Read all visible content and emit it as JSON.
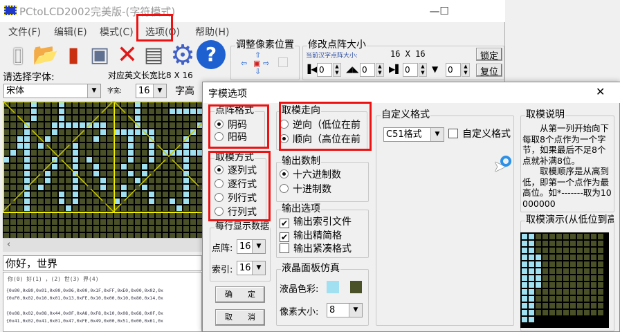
{
  "window": {
    "title": "PCtoLCD2002完美版-(字符模式)",
    "min": "—",
    "max": "☐"
  },
  "menu": [
    "文件(F)",
    "编辑(E)",
    "模式(C)",
    "选项(O)",
    "帮助(H)"
  ],
  "toolbar_icons": [
    "new-icon",
    "open-icon",
    "save-icon",
    "disk-restore-icon",
    "delete-icon",
    "document-icon",
    "gear-icon",
    "help-icon"
  ],
  "pixel_adjust": {
    "label": "调整像素位置"
  },
  "matrix_size": {
    "label": "修改点阵大小",
    "current_label": "当前汉字点阵大小:",
    "current_value": "16 X 16",
    "lock": "锁定",
    "reset": "复位",
    "spins": [
      "0",
      "0",
      "0",
      "0"
    ]
  },
  "font": {
    "label": "请选择字体:",
    "value": "宋体",
    "ratio": "对应英文长宽比8 X 16",
    "width_label": "字宽:",
    "width_value": "16",
    "height_label": "字高"
  },
  "input_text": "你好，世界",
  "output": {
    "index_line": "你(0) 好(1) ，(2) 世(3) 界(4)",
    "lines": [
      "{0x00,0x80,0x01,0x00,0x06,0x00,0x1F,0xFF,0xE0,0x00,0x02,0x",
      "{0xF0,0x02,0x10,0x01,0x13,0xFE,0x10,0x00,0x10,0x80,0x14,0x",
      "",
      "{0x08,0x02,0x08,0x44,0x0F,0xA8,0xF8,0x10,0x08,0x68,0x0F,0x",
      "{0x41,0x02,0x41,0x01,0x47,0xFE,0x49,0x00,0x51,0x00,0x61,0x"
    ]
  },
  "dialog": {
    "title": "字模选项",
    "close": "✕",
    "dot_format": {
      "label": "点阵格式",
      "options": [
        "阴码",
        "阳码"
      ],
      "selected": 0
    },
    "mode": {
      "label": "取模方式",
      "options": [
        "逐列式",
        "逐行式",
        "列行式",
        "行列式"
      ],
      "selected": 0
    },
    "direction": {
      "label": "取模走向",
      "options": [
        "逆向（低位在前",
        "顺向（高位在前"
      ],
      "selected": 1
    },
    "radix": {
      "label": "输出数制",
      "options": [
        "十六进制数",
        "十进制数"
      ],
      "selected": 0
    },
    "output_opts": {
      "label": "输出选项",
      "items": [
        {
          "label": "输出索引文件",
          "checked": true
        },
        {
          "label": "输出精简格",
          "checked": true
        },
        {
          "label": "输出紧凑格式",
          "checked": false
        }
      ]
    },
    "per_line": {
      "label": "每行显示数据",
      "dot_label": "点阵:",
      "dot_value": "16",
      "index_label": "索引:",
      "index_value": "16"
    },
    "ok": "确　　定",
    "cancel": "取　　消",
    "lcd": {
      "label": "液晶面板仿真",
      "color_label": "液晶色彩:",
      "on_color": "#a0e0f0",
      "off_color": "#4a5028",
      "pixel_label": "像素大小:",
      "pixel_value": "8"
    },
    "custom": {
      "label": "自定义格式",
      "select": "C51格式",
      "check_label": "自定义格式"
    },
    "explain": {
      "label": "取模说明",
      "text": "　　从第一列开始向下每取8个点作为一个字节，如果最后不足8个点就补满8位。\n　　取模顺序是从高到低，即第一个点作为最高位。如*-------取为10000000"
    },
    "demo": {
      "label": "取模演示(从低位到高位)"
    }
  },
  "bitmap": {
    "char1": [
      [
        4,
        8
      ],
      [
        4,
        8
      ],
      [
        4,
        8
      ],
      [
        3,
        7,
        8,
        9,
        10,
        11,
        12,
        13,
        14
      ],
      [
        3,
        7,
        14
      ],
      [
        2,
        3,
        6,
        13
      ],
      [
        2,
        3,
        5,
        10
      ],
      [
        1,
        3,
        10
      ],
      [
        0,
        3,
        7,
        10,
        12
      ],
      [
        3,
        7,
        10,
        13
      ],
      [
        3,
        6,
        10,
        13
      ],
      [
        3,
        6,
        10,
        14
      ],
      [
        3,
        5,
        10,
        14
      ],
      [
        3,
        8,
        10
      ],
      [
        3,
        8,
        10
      ],
      [
        3,
        9
      ]
    ],
    "char2": [
      [
        3
      ],
      [
        3,
        8,
        9,
        10,
        11,
        12
      ],
      [
        3
      ],
      [
        3,
        12
      ],
      [
        0,
        1,
        2,
        3,
        4,
        5,
        11
      ],
      [
        2,
        5,
        10
      ],
      [
        2,
        5,
        10
      ],
      [
        2,
        5,
        7,
        8,
        9,
        10,
        11,
        12
      ],
      [
        2,
        5,
        10
      ],
      [
        1,
        4,
        10
      ],
      [
        2,
        4,
        10
      ],
      [
        3,
        10
      ],
      [
        1,
        4,
        10
      ],
      [
        1,
        5,
        10
      ],
      [
        0,
        5,
        8,
        10
      ],
      [
        9
      ]
    ]
  }
}
